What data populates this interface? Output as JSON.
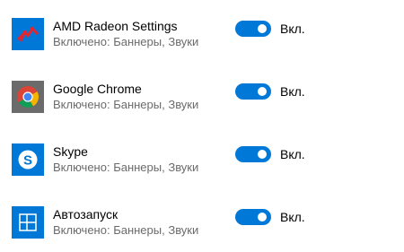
{
  "apps": [
    {
      "name": "AMD Radeon Settings",
      "subtitle": "Включено: Баннеры, Звуки",
      "icon": "amd-radeon-icon",
      "icon_bg": "#0078d7",
      "toggle_on": true,
      "state_label": "Вкл."
    },
    {
      "name": "Google Chrome",
      "subtitle": "Включено: Баннеры, Звуки",
      "icon": "chrome-icon",
      "icon_bg": "#6b6b6b",
      "toggle_on": true,
      "state_label": "Вкл."
    },
    {
      "name": "Skype",
      "subtitle": "Включено: Баннеры, Звуки",
      "icon": "skype-icon",
      "icon_bg": "#0078d7",
      "toggle_on": true,
      "state_label": "Вкл."
    },
    {
      "name": "Автозапуск",
      "subtitle": "Включено: Баннеры, Звуки",
      "icon": "autoplay-icon",
      "icon_bg": "#0078d7",
      "toggle_on": true,
      "state_label": "Вкл."
    }
  ],
  "colors": {
    "accent": "#0078d7",
    "subtitle": "#6b6b6b"
  }
}
